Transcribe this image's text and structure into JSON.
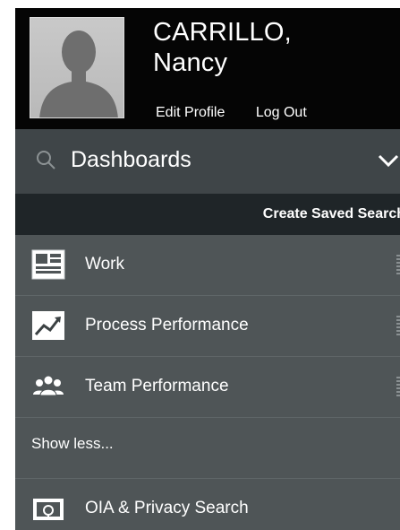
{
  "profile": {
    "last_name": "CARRILLO,",
    "first_name": "Nancy",
    "edit_profile_label": "Edit Profile",
    "logout_label": "Log Out"
  },
  "dashboards": {
    "title": "Dashboards",
    "create_saved_search_label": "Create Saved Search"
  },
  "menu": {
    "items": [
      {
        "label": "Work",
        "icon": "work-list-icon"
      },
      {
        "label": "Process Performance",
        "icon": "trend-chart-icon"
      },
      {
        "label": "Team Performance",
        "icon": "team-icon"
      }
    ],
    "show_less_label": "Show less...",
    "extra_item": {
      "label": "OIA & Privacy Search",
      "icon": "privacy-search-icon"
    }
  },
  "colors": {
    "header_bg": "#050505",
    "dashbar_bg": "#3f4548",
    "savebar_bg": "#1f2528",
    "menu_bg": "#4f5557"
  }
}
